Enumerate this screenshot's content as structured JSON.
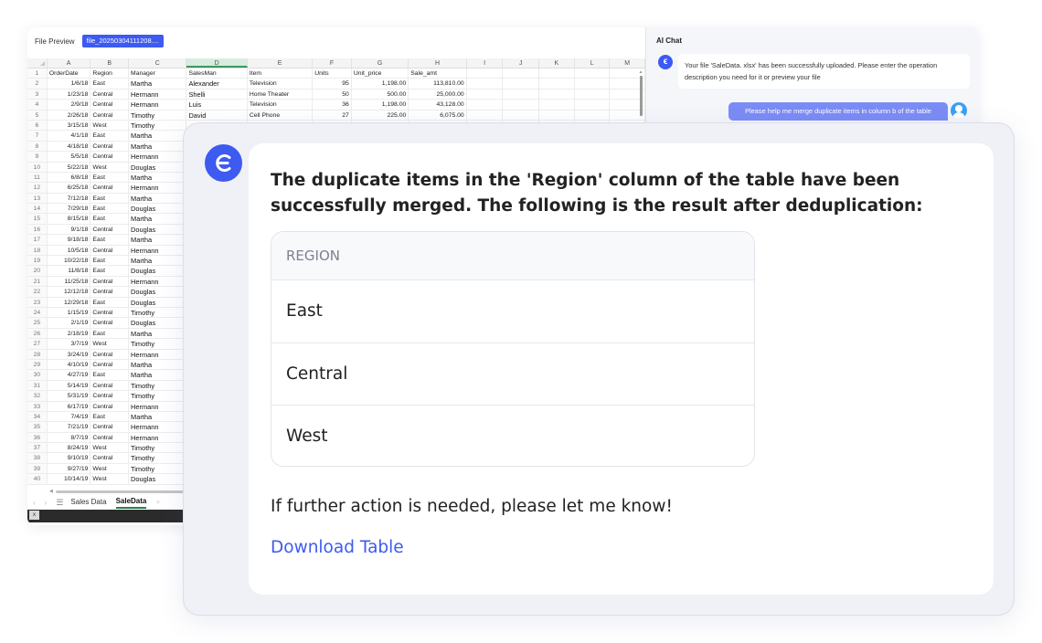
{
  "preview": {
    "title": "File Preview",
    "file_tab": "file_20250304111208....",
    "columns": [
      "A",
      "B",
      "C",
      "D",
      "E",
      "F",
      "G",
      "H",
      "I",
      "J",
      "K",
      "L",
      "M"
    ],
    "selected_column": "D",
    "header_row": {
      "num": "1",
      "a": "OrderDate",
      "b": "Region",
      "c": "Manager",
      "d": "SalesMan",
      "e": "Item",
      "f": "Units",
      "g": "Unit_price",
      "h": "Sale_amt"
    },
    "rows": [
      {
        "num": "2",
        "a": "1/6/18",
        "b": "East",
        "c": "Martha",
        "d": "Alexander",
        "e": "Television",
        "f": "95",
        "g": "1,198.00",
        "h": "113,810.00"
      },
      {
        "num": "3",
        "a": "1/23/18",
        "b": "Central",
        "c": "Hermann",
        "d": "Shelli",
        "e": "Home Theater",
        "f": "50",
        "g": "500.00",
        "h": "25,000.00"
      },
      {
        "num": "4",
        "a": "2/9/18",
        "b": "Central",
        "c": "Hermann",
        "d": "Luis",
        "e": "Television",
        "f": "36",
        "g": "1,198.00",
        "h": "43,128.00"
      },
      {
        "num": "5",
        "a": "2/26/18",
        "b": "Central",
        "c": "Timothy",
        "d": "David",
        "e": "Cell Phone",
        "f": "27",
        "g": "225.00",
        "h": "6,075.00"
      },
      {
        "num": "6",
        "a": "3/15/18",
        "b": "West",
        "c": "Timothy",
        "d": "",
        "e": "",
        "f": "",
        "g": "",
        "h": ""
      },
      {
        "num": "7",
        "a": "4/1/18",
        "b": "East",
        "c": "Martha"
      },
      {
        "num": "8",
        "a": "4/18/18",
        "b": "Central",
        "c": "Martha"
      },
      {
        "num": "9",
        "a": "5/5/18",
        "b": "Central",
        "c": "Hermann"
      },
      {
        "num": "10",
        "a": "5/22/18",
        "b": "West",
        "c": "Douglas"
      },
      {
        "num": "11",
        "a": "6/8/18",
        "b": "East",
        "c": "Martha"
      },
      {
        "num": "12",
        "a": "6/25/18",
        "b": "Central",
        "c": "Hermann"
      },
      {
        "num": "13",
        "a": "7/12/18",
        "b": "East",
        "c": "Martha"
      },
      {
        "num": "14",
        "a": "7/29/18",
        "b": "East",
        "c": "Douglas"
      },
      {
        "num": "15",
        "a": "8/15/18",
        "b": "East",
        "c": "Martha"
      },
      {
        "num": "16",
        "a": "9/1/18",
        "b": "Central",
        "c": "Douglas"
      },
      {
        "num": "17",
        "a": "9/18/18",
        "b": "East",
        "c": "Martha"
      },
      {
        "num": "18",
        "a": "10/5/18",
        "b": "Central",
        "c": "Hermann"
      },
      {
        "num": "19",
        "a": "10/22/18",
        "b": "East",
        "c": "Martha"
      },
      {
        "num": "20",
        "a": "11/8/18",
        "b": "East",
        "c": "Douglas"
      },
      {
        "num": "21",
        "a": "11/25/18",
        "b": "Central",
        "c": "Hermann"
      },
      {
        "num": "22",
        "a": "12/12/18",
        "b": "Central",
        "c": "Douglas"
      },
      {
        "num": "23",
        "a": "12/29/18",
        "b": "East",
        "c": "Douglas"
      },
      {
        "num": "24",
        "a": "1/15/19",
        "b": "Central",
        "c": "Timothy"
      },
      {
        "num": "25",
        "a": "2/1/19",
        "b": "Central",
        "c": "Douglas"
      },
      {
        "num": "26",
        "a": "2/18/19",
        "b": "East",
        "c": "Martha"
      },
      {
        "num": "27",
        "a": "3/7/19",
        "b": "West",
        "c": "Timothy"
      },
      {
        "num": "28",
        "a": "3/24/19",
        "b": "Central",
        "c": "Hermann"
      },
      {
        "num": "29",
        "a": "4/10/19",
        "b": "Central",
        "c": "Martha"
      },
      {
        "num": "30",
        "a": "4/27/19",
        "b": "East",
        "c": "Martha"
      },
      {
        "num": "31",
        "a": "5/14/19",
        "b": "Central",
        "c": "Timothy"
      },
      {
        "num": "32",
        "a": "5/31/19",
        "b": "Central",
        "c": "Timothy"
      },
      {
        "num": "33",
        "a": "6/17/19",
        "b": "Central",
        "c": "Hermann"
      },
      {
        "num": "34",
        "a": "7/4/19",
        "b": "East",
        "c": "Martha"
      },
      {
        "num": "35",
        "a": "7/21/19",
        "b": "Central",
        "c": "Hermann"
      },
      {
        "num": "36",
        "a": "8/7/19",
        "b": "Central",
        "c": "Hermann"
      },
      {
        "num": "37",
        "a": "8/24/19",
        "b": "West",
        "c": "Timothy"
      },
      {
        "num": "38",
        "a": "9/10/19",
        "b": "Central",
        "c": "Timothy"
      },
      {
        "num": "39",
        "a": "9/27/19",
        "b": "West",
        "c": "Timothy"
      },
      {
        "num": "40",
        "a": "10/14/19",
        "b": "West",
        "c": "Douglas"
      }
    ],
    "sheet_tabs": [
      {
        "label": "Sales Data",
        "active": false
      },
      {
        "label": "SaleData",
        "active": true
      }
    ],
    "sheet_add": "+",
    "sheet_menu": "☰",
    "sheet_prev": "‹",
    "sheet_next": "›"
  },
  "chat": {
    "title": "AI Chat",
    "bot_avatar_glyph": "ϵ",
    "messages": [
      {
        "role": "bot",
        "text": "Your file 'SaleData. xlsx' has been successfully uploaded. Please enter the operation description you need for it or preview your file"
      },
      {
        "role": "user",
        "text": "Please help me merge duplicate items in column b of the table"
      }
    ]
  },
  "reply": {
    "intro": "The duplicate items in the 'Region' column of the table have been successfully merged. The following is the result after deduplication:",
    "table_header": "REGION",
    "table_rows": [
      "East",
      "Central",
      "West"
    ],
    "outro": "If further action is needed, please let me know!",
    "download_label": "Download Table"
  },
  "colors": {
    "accent": "#3d5af1",
    "user_bubble": "#7b8cf5",
    "user_avatar": "#3aa0f5",
    "selected_column": "#d8ecdf"
  }
}
